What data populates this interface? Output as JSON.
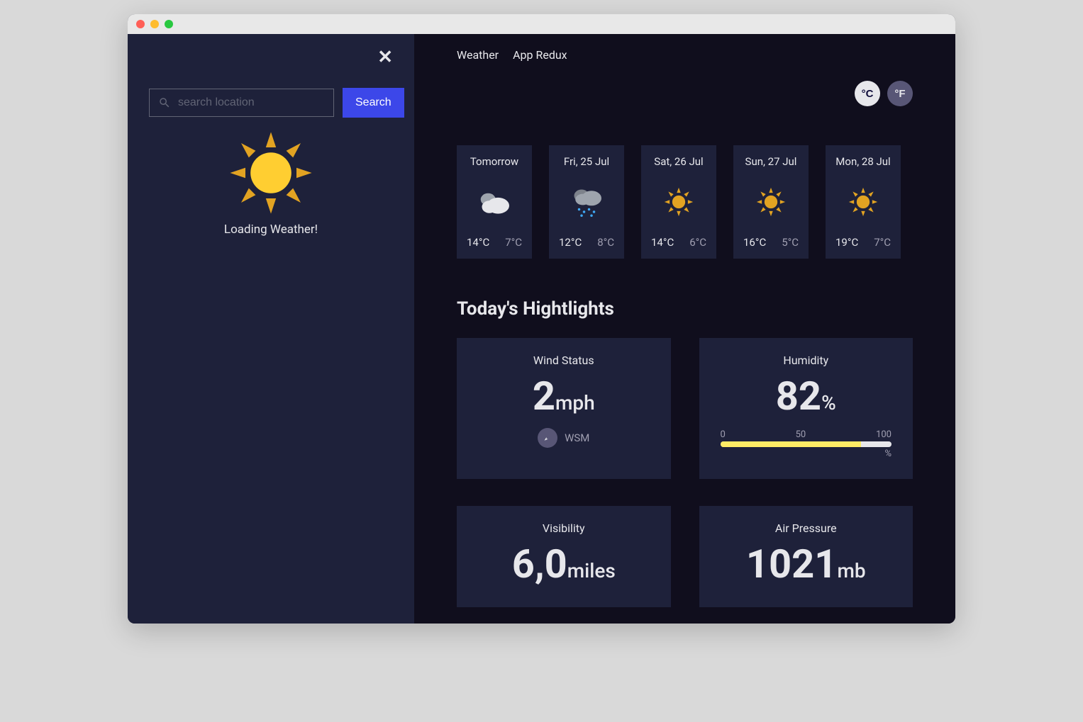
{
  "nav": {
    "item1": "Weather",
    "item2": "App Redux"
  },
  "units": {
    "c": "°C",
    "f": "°F",
    "active": "c"
  },
  "sidebar": {
    "search_placeholder": "search location",
    "search_button": "Search",
    "loading_text": "Loading Weather!"
  },
  "forecast": [
    {
      "day": "Tomorrow",
      "icon": "cloud",
      "hi": "14°C",
      "lo": "7°C"
    },
    {
      "day": "Fri, 25 Jul",
      "icon": "rain",
      "hi": "12°C",
      "lo": "8°C"
    },
    {
      "day": "Sat, 26 Jul",
      "icon": "sun",
      "hi": "14°C",
      "lo": "6°C"
    },
    {
      "day": "Sun, 27 Jul",
      "icon": "sun",
      "hi": "16°C",
      "lo": "5°C"
    },
    {
      "day": "Mon, 28 Jul",
      "icon": "sun",
      "hi": "19°C",
      "lo": "7°C"
    }
  ],
  "highlights": {
    "title": "Today's Hightlights",
    "wind": {
      "label": "Wind Status",
      "value": "2",
      "unit": "mph",
      "dir": "WSM"
    },
    "humidity": {
      "label": "Humidity",
      "value": "82",
      "unit": "%",
      "scale0": "0",
      "scale50": "50",
      "scale100": "100",
      "pct": "%"
    },
    "visibility": {
      "label": "Visibility",
      "value": "6,0",
      "unit": "miles"
    },
    "pressure": {
      "label": "Air Pressure",
      "value": "1021",
      "unit": "mb"
    }
  }
}
